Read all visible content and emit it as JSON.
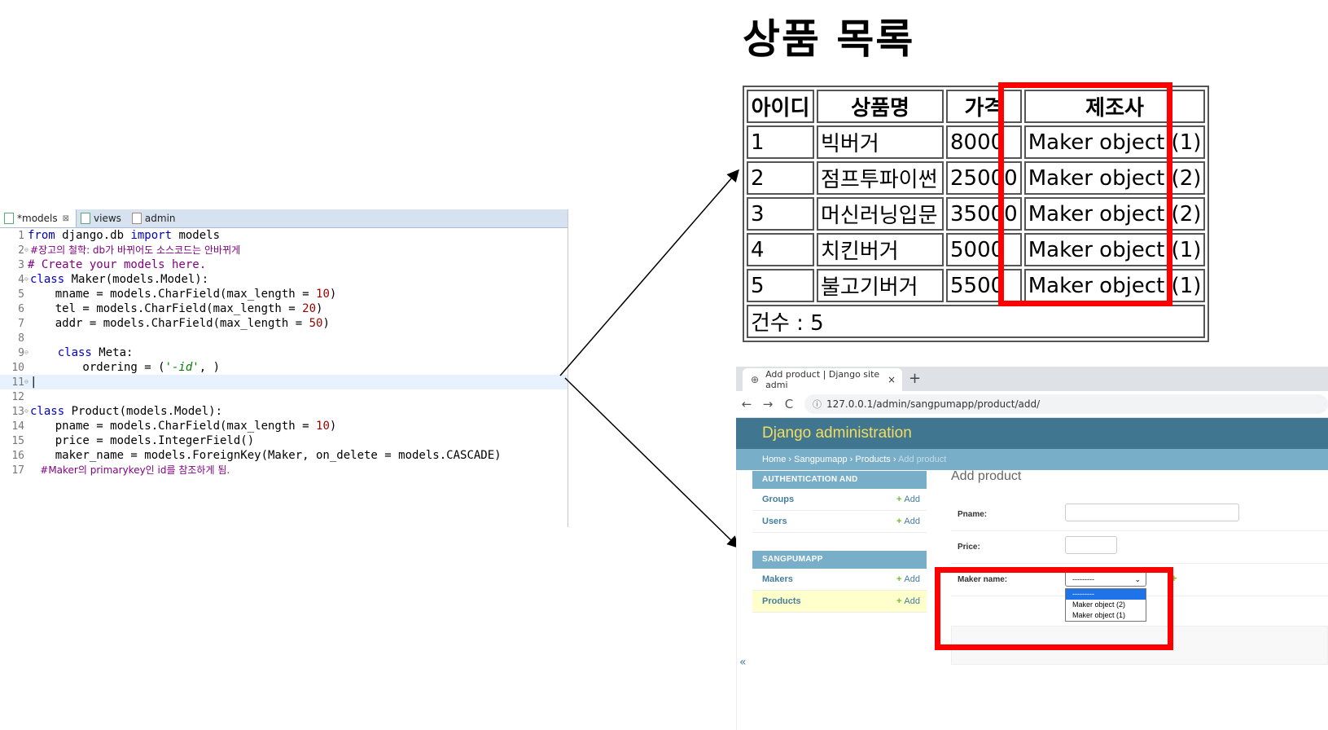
{
  "editor": {
    "tabs": [
      {
        "label": "*models",
        "close": "⊠"
      },
      {
        "label": "views"
      },
      {
        "label": "admin"
      }
    ],
    "lines": [
      {
        "n": "1",
        "t1": "from",
        "t2": " django.db ",
        "t3": "import",
        "t4": " models"
      },
      {
        "n": "2",
        "comment": "#장고의 철학: db가 바뀌어도 소스코드는 안바뀌게"
      },
      {
        "n": "3",
        "comment": "# Create your models here."
      },
      {
        "n": "4",
        "kw": "class",
        "rest": " Maker(models.Model):"
      },
      {
        "n": "5",
        "pre": "    mname = models.CharField(max_length = ",
        "num": "10",
        "post": ")"
      },
      {
        "n": "6",
        "pre": "    tel = models.CharField(max_length = ",
        "num": "20",
        "post": ")"
      },
      {
        "n": "7",
        "pre": "    addr = models.CharField(max_length = ",
        "num": "50",
        "post": ")"
      },
      {
        "n": "8"
      },
      {
        "n": "9",
        "kw": "    class",
        "rest": " Meta:"
      },
      {
        "n": "10",
        "pre": "        ordering = (",
        "str": "'-id'",
        "post": ", )"
      },
      {
        "n": "11"
      },
      {
        "n": "12"
      },
      {
        "n": "13",
        "kw": "class",
        "rest": " Product(models.Model):"
      },
      {
        "n": "14",
        "pre": "    pname = models.CharField(max_length = ",
        "num": "10",
        "post": ")"
      },
      {
        "n": "15",
        "text": "    price = models.IntegerField()"
      },
      {
        "n": "16",
        "text": "    maker_name = models.ForeignKey(Maker, on_delete = models.CASCADE)"
      },
      {
        "n": "17",
        "comment": "    #Maker의 primarykey인 id를 참조하게 됨."
      }
    ]
  },
  "product_list": {
    "title": "상품 목록",
    "headers": [
      "아이디",
      "상품명",
      "가격",
      "제조사"
    ],
    "rows": [
      {
        "id": "1",
        "name": "빅버거",
        "price": "8000",
        "maker": "Maker object (1)"
      },
      {
        "id": "2",
        "name": "점프투파이썬",
        "price": "25000",
        "maker": "Maker object (2)"
      },
      {
        "id": "3",
        "name": "머신러닝입문",
        "price": "35000",
        "maker": "Maker object (2)"
      },
      {
        "id": "4",
        "name": "치킨버거",
        "price": "5000",
        "maker": "Maker object (1)"
      },
      {
        "id": "5",
        "name": "불고기버거",
        "price": "5500",
        "maker": "Maker object (1)"
      }
    ],
    "count": "건수 : 5"
  },
  "browser": {
    "tab_title": "Add product | Django site admi",
    "tab_close": "×",
    "new_tab": "+",
    "url": "127.0.0.1/admin/sangpumapp/product/add/",
    "back": "←",
    "forward": "→",
    "reload": "C"
  },
  "admin": {
    "header": "Django administration",
    "breadcrumb": {
      "home": "Home",
      "app": "Sangpumapp",
      "model": "Products",
      "current": "Add product",
      "sep": "›"
    },
    "nav": [
      {
        "caption": "AUTHENTICATION AND AUTHORIZATION",
        "items": [
          {
            "name": "Groups",
            "add": "Add"
          },
          {
            "name": "Users",
            "add": "Add"
          }
        ]
      },
      {
        "caption": "SANGPUMAPP",
        "items": [
          {
            "name": "Makers",
            "add": "Add"
          },
          {
            "name": "Products",
            "add": "Add"
          }
        ]
      }
    ],
    "toggle": "«",
    "page_title": "Add product",
    "fields": {
      "pname_label": "Pname:",
      "price_label": "Price:",
      "maker_label": "Maker name:",
      "maker_selected": "---------",
      "maker_options": [
        "---------",
        "Maker object (2)",
        "Maker object (1)"
      ]
    }
  },
  "colors": {
    "highlight": "#ff0000",
    "django_header": "#417690",
    "django_accent": "#79aec8",
    "django_yellow": "#f5dd5d"
  }
}
